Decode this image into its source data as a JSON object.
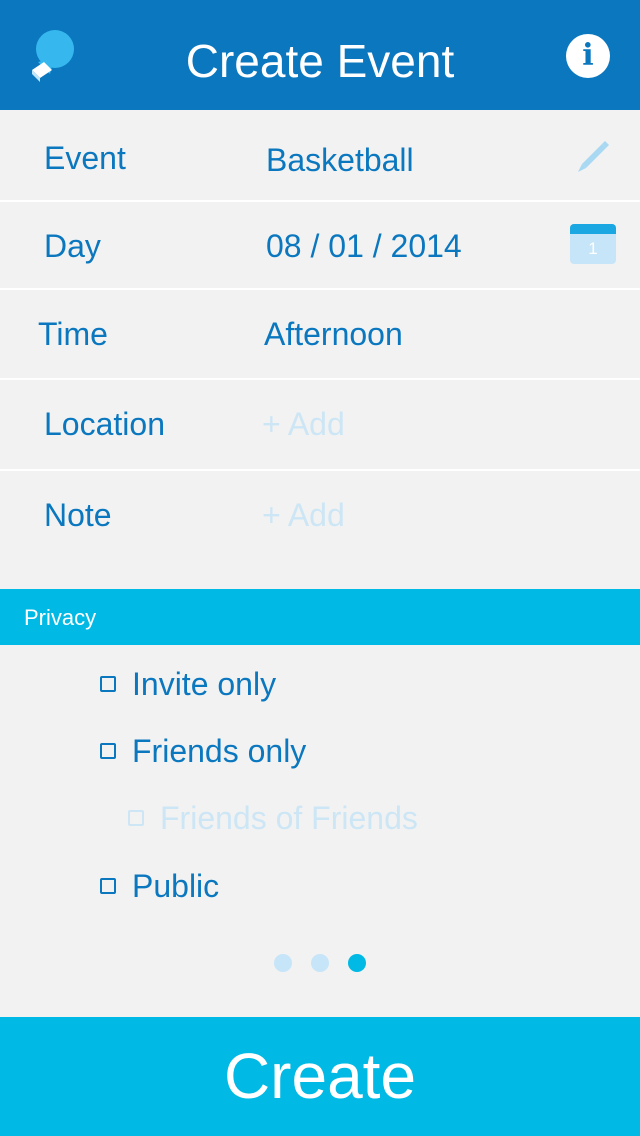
{
  "header": {
    "title": "Create Event",
    "info_glyph": "i",
    "logo_icon": "chat-bubble-logo-icon",
    "info_icon": "info-icon",
    "bar_color": "#0a77bf"
  },
  "form": {
    "event": {
      "label": "Event",
      "value": "Basketball",
      "icon": "pencil-icon"
    },
    "day": {
      "label": "Day",
      "value": "08 / 01 / 2014",
      "icon": "calendar-icon",
      "icon_text": "1"
    },
    "time": {
      "label": "Time",
      "value": "Afternoon"
    },
    "location": {
      "label": "Location",
      "placeholder": "+ Add"
    },
    "note": {
      "label": "Note",
      "placeholder": "+ Add"
    }
  },
  "privacy": {
    "section_label": "Privacy",
    "options": [
      {
        "label": "Invite only",
        "enabled": true
      },
      {
        "label": "Friends only",
        "enabled": true
      },
      {
        "label": "Friends of Friends",
        "enabled": false
      },
      {
        "label": "Public",
        "enabled": true
      }
    ],
    "accent_color": "#00b9e4"
  },
  "pager": {
    "page_count": 3,
    "current_page": 3
  },
  "footer": {
    "create_label": "Create"
  }
}
